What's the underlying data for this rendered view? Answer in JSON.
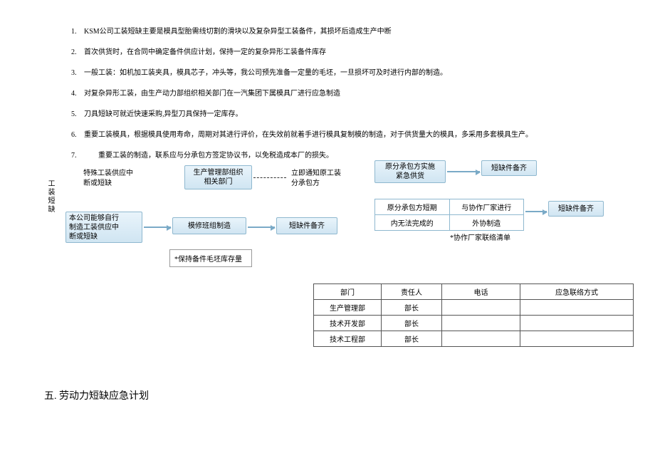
{
  "list": [
    "KSM公司工装短缺主要是模具型胎需线切割的滑块以及复杂异型工装备件，其损坏后造成生产中断",
    "首次供货时，在合同中确定备件供应计划，保持一定的复杂异形工装备件库存",
    "一般工装：如机加工装夹具，模具芯子，冲头等，我公司预先准备一定量的毛坯，一旦损坏可及时进行内部的制造。",
    "对复杂异形工装，由生产动力部组织相关部门在一汽集团下属模具厂进行应急制造",
    "刀具短缺可就近快速采购,异型刀具保持一定库存。",
    "重要工装模具，根据模具使用寿命，周期对其进行评价，在失效前就着手进行模具复制模的制造，对于供货量大的模具，多采用多套模具生产。",
    "　　重要工装的制造，联系应与分承包方签定协议书，以免税造成本厂的损失。"
  ],
  "vlabel": "工装短缺",
  "flow": {
    "specialSupply": "特殊工装供应中\n断或短缺",
    "pmOrg": {
      "line1": "生产管理部组织",
      "line2": "相关部门"
    },
    "notify": "立即通知原工装\n分承包方",
    "subEmergency": "原分承包方实施\n紧急供货",
    "partsReady1": "短缺件备齐",
    "selfMake": "本公司能够自行\n制造工装供应中\n断或短缺",
    "repairGroup": "模修班组制造",
    "partsReady2": "短缺件备齐",
    "keepStock": "*保持备件毛坯库存量",
    "outsrc": {
      "r0c0": "原分承包方短期",
      "r0c1": "与协作厂家进行",
      "r1c0": "内无法完成的",
      "r1c1": "外协制造"
    },
    "partsReady3": "短缺件备齐",
    "partnerList": "*协作厂家联络清单"
  },
  "table": {
    "headers": [
      "部门",
      "责任人",
      "电话",
      "应急联络方式"
    ],
    "rows": [
      [
        "生产管理部",
        "部长",
        "",
        ""
      ],
      [
        "技术开发部",
        "部长",
        "",
        ""
      ],
      [
        "技术工程部",
        "部长",
        "",
        ""
      ]
    ]
  },
  "section5": "五. 劳动力短缺应急计划"
}
